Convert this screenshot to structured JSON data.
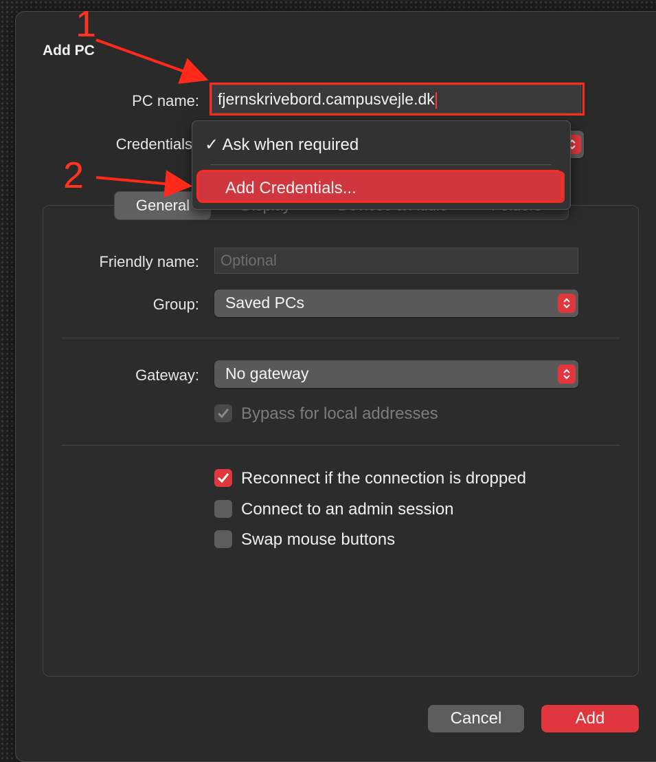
{
  "dialog": {
    "title": "Add PC"
  },
  "pc_name": {
    "label": "PC name:",
    "value": "fjernskrivebord.campusvejle.dk"
  },
  "credentials": {
    "label": "Credentials",
    "menu": {
      "item_checked": "Ask when required",
      "item_highlighted": "Add Credentials..."
    }
  },
  "tabs": [
    "General",
    "Display",
    "Devices & Audio",
    "Folders"
  ],
  "friendly_name": {
    "label": "Friendly name:",
    "placeholder": "Optional"
  },
  "group": {
    "label": "Group:",
    "value": "Saved PCs"
  },
  "gateway": {
    "label": "Gateway:",
    "value": "No gateway"
  },
  "checkboxes": {
    "bypass": {
      "label": "Bypass for local addresses",
      "checked": true,
      "disabled": true
    },
    "reconnect": {
      "label": "Reconnect if the connection is dropped",
      "checked": true
    },
    "admin": {
      "label": "Connect to an admin session",
      "checked": false
    },
    "swap": {
      "label": "Swap mouse buttons",
      "checked": false
    }
  },
  "buttons": {
    "cancel": "Cancel",
    "add": "Add"
  },
  "annotations": {
    "one": "1",
    "two": "2"
  },
  "colors": {
    "accent": "#e0373f",
    "annotation": "#ff2a1a",
    "background": "#2b2a2a"
  },
  "icons": [
    "checkmark-icon",
    "stepper-icon",
    "annotation-arrow"
  ]
}
